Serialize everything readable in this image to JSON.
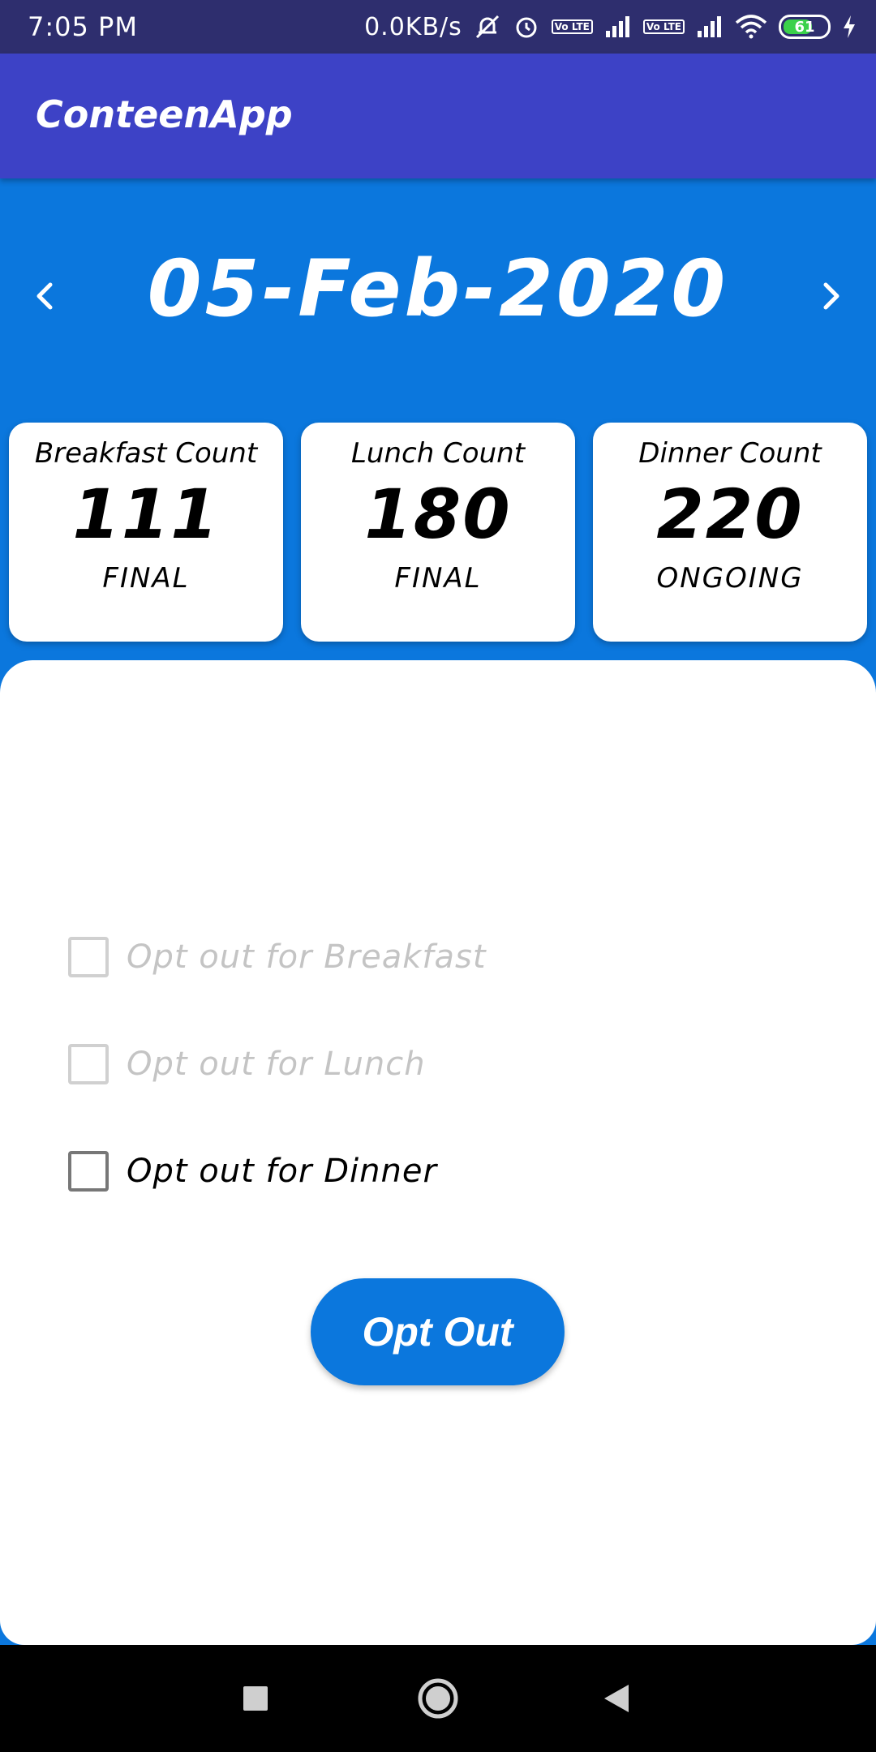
{
  "status_bar": {
    "time": "7:05 PM",
    "net_speed": "0.0KB/s",
    "volte_1": "Vo LTE",
    "volte_2": "Vo LTE",
    "battery_level": "61",
    "icons": [
      "mute-icon",
      "alarm-icon",
      "signal-icon",
      "wifi-icon",
      "battery-icon",
      "charging-icon"
    ]
  },
  "app_bar": {
    "title": "ConteenApp",
    "color": "#3d42c6"
  },
  "date_nav": {
    "date": "05-Feb-2020",
    "prev_icon": "chevron-left-icon",
    "next_icon": "chevron-right-icon"
  },
  "cards": [
    {
      "title": "Breakfast Count",
      "count": "111",
      "status": "FINAL"
    },
    {
      "title": "Lunch Count",
      "count": "180",
      "status": "FINAL"
    },
    {
      "title": "Dinner Count",
      "count": "220",
      "status": "ONGOING"
    }
  ],
  "options": [
    {
      "label": "Opt out for Breakfast",
      "enabled": false,
      "checked": false
    },
    {
      "label": "Opt out for Lunch",
      "enabled": false,
      "checked": false
    },
    {
      "label": "Opt out for Dinner",
      "enabled": true,
      "checked": false
    }
  ],
  "opt_out_button": {
    "label": "Opt Out"
  },
  "colors": {
    "primary": "#0b77dd",
    "app_bar": "#3d42c6",
    "status_bar": "#2e2e6e"
  },
  "system_nav": {
    "icons": [
      "recents-icon",
      "home-icon",
      "back-icon"
    ]
  }
}
